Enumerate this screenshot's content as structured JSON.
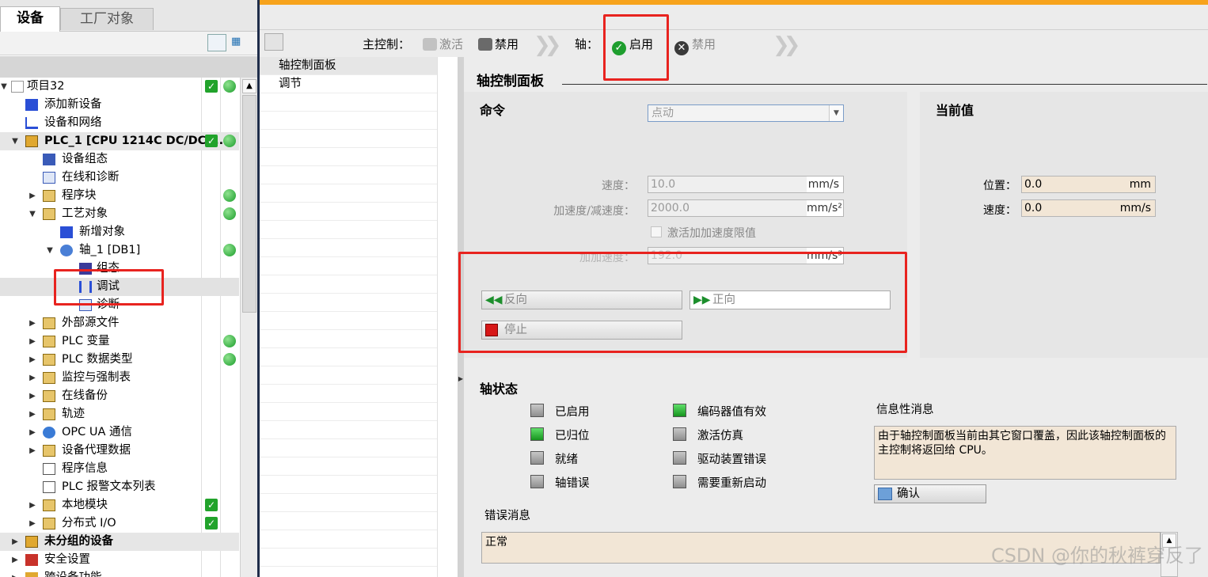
{
  "tabs": {
    "devices": "设备",
    "plant_objects": "工厂对象"
  },
  "tree": [
    {
      "label": "项目32",
      "ok": true,
      "dot": true
    },
    {
      "label": "添加新设备"
    },
    {
      "label": "设备和网络"
    },
    {
      "label": "PLC_1 [CPU 1214C DC/DC/...",
      "ok": true,
      "dot": true
    },
    {
      "label": "设备组态"
    },
    {
      "label": "在线和诊断"
    },
    {
      "label": "程序块",
      "dot": true
    },
    {
      "label": "工艺对象",
      "dot": true
    },
    {
      "label": "新增对象"
    },
    {
      "label": "轴_1 [DB1]",
      "dot": true
    },
    {
      "label": "组态"
    },
    {
      "label": "调试"
    },
    {
      "label": "诊断"
    },
    {
      "label": "外部源文件"
    },
    {
      "label": "PLC 变量",
      "dot": true
    },
    {
      "label": "PLC 数据类型",
      "dot": true
    },
    {
      "label": "监控与强制表"
    },
    {
      "label": "在线备份"
    },
    {
      "label": "轨迹"
    },
    {
      "label": "OPC UA 通信"
    },
    {
      "label": "设备代理数据"
    },
    {
      "label": "程序信息"
    },
    {
      "label": "PLC 报警文本列表"
    },
    {
      "label": "本地模块",
      "ok": true
    },
    {
      "label": "分布式 I/O",
      "ok": true
    },
    {
      "label": "未分组的设备"
    },
    {
      "label": "安全设置"
    },
    {
      "label": "跨设备功能"
    }
  ],
  "toolbar": {
    "master_label": "主控制：",
    "activate": "激活",
    "disable": "禁用",
    "axis_label": "轴：",
    "enable": "启用",
    "axis_disable": "禁用"
  },
  "nav": {
    "items": [
      "轴控制面板",
      "调节"
    ]
  },
  "panel": {
    "title": "轴控制面板",
    "command": {
      "header": "命令",
      "mode": "点动",
      "speed_label": "速度：",
      "speed_value": "10.0",
      "speed_unit": "mm/s",
      "accel_label": "加速度/减速度：",
      "accel_value": "2000.0",
      "accel_unit": "mm/s²",
      "jerk_checkbox": "激活加加速度限值",
      "jerk_label": "加加速度：",
      "jerk_value": "192.0",
      "jerk_unit": "mm/s³",
      "reverse": "反向",
      "forward": "正向",
      "stop": "停止"
    },
    "current": {
      "header": "当前值",
      "position_label": "位置：",
      "position_value": "0.0",
      "position_unit": "mm",
      "speed_label": "速度：",
      "speed_value": "0.0",
      "speed_unit": "mm/s"
    },
    "status": {
      "header": "轴状态",
      "flags": [
        {
          "label": "已启用",
          "on": false
        },
        {
          "label": "已归位",
          "on": true
        },
        {
          "label": "就绪",
          "on": false
        },
        {
          "label": "轴错误",
          "on": false
        },
        {
          "label": "编码器值有效",
          "on": true
        },
        {
          "label": "激活仿真",
          "on": false
        },
        {
          "label": "驱动装置错误",
          "on": false
        },
        {
          "label": "需要重新启动",
          "on": false
        }
      ],
      "info_label": "信息性消息",
      "info_text": "由于轴控制面板当前由其它窗口覆盖，因此该轴控制面板的主控制将返回给 CPU。",
      "confirm": "确认",
      "error_label": "错误消息",
      "error_text": "正常"
    }
  },
  "watermark": "CSDN @你的秋裤穿反了",
  "colors": {
    "accent_orange": "#f7a31c",
    "ok_green": "#21a32b",
    "highlight_red": "#e8231f",
    "value_bg": "#f2e6d6"
  }
}
